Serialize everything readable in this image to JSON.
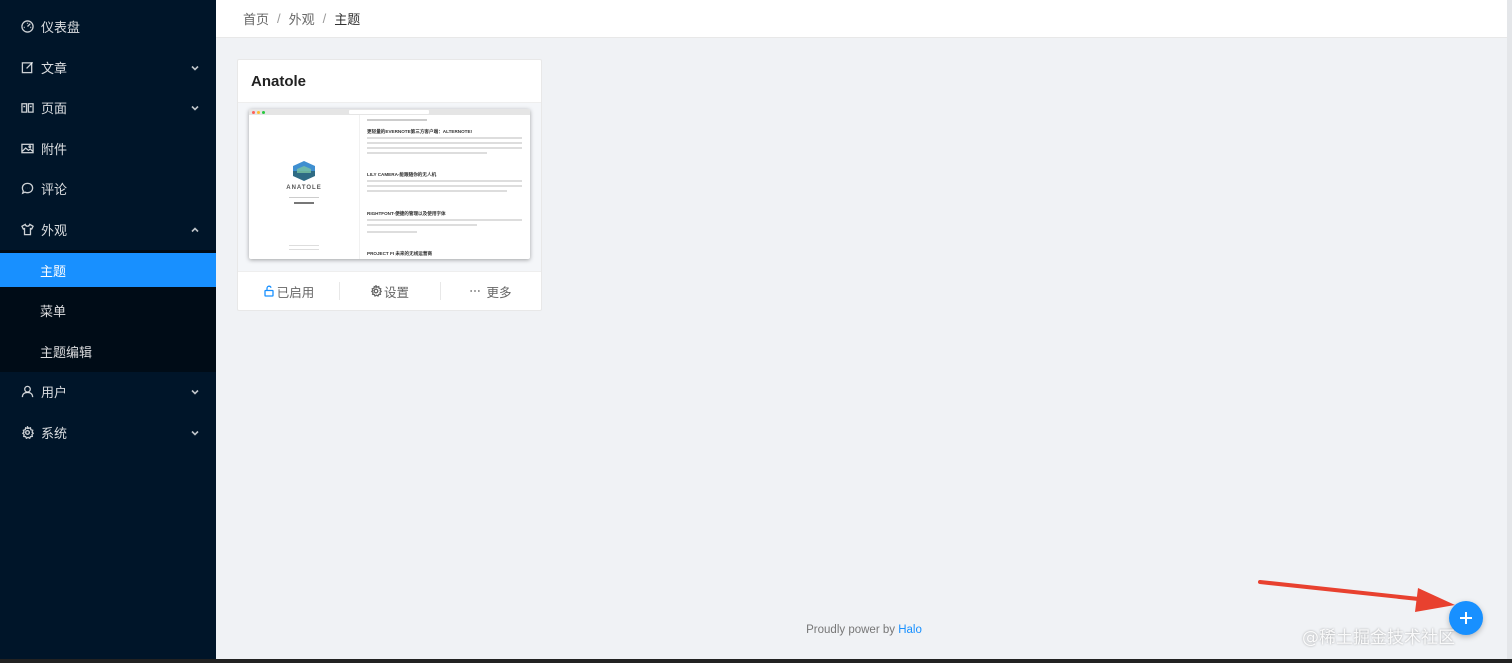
{
  "sidebar": {
    "items": [
      {
        "label": "仪表盘",
        "icon": "dashboard-icon",
        "has_arrow": false
      },
      {
        "label": "文章",
        "icon": "edit-icon",
        "has_arrow": true
      },
      {
        "label": "页面",
        "icon": "book-icon",
        "has_arrow": true
      },
      {
        "label": "附件",
        "icon": "picture-icon",
        "has_arrow": true
      },
      {
        "label": "评论",
        "icon": "comment-icon",
        "has_arrow": false
      },
      {
        "label": "外观",
        "icon": "skin-icon",
        "has_arrow": true,
        "expanded": true
      },
      {
        "label": "用户",
        "icon": "user-icon",
        "has_arrow": true
      },
      {
        "label": "系统",
        "icon": "setting-icon",
        "has_arrow": true
      }
    ],
    "submenu": [
      {
        "label": "主题",
        "active": true
      },
      {
        "label": "菜单",
        "active": false
      },
      {
        "label": "主题编辑",
        "active": false
      }
    ]
  },
  "breadcrumb": [
    "首页",
    "外观",
    "主题"
  ],
  "theme_card": {
    "title": "Anatole",
    "preview": {
      "logo_text": "ANATOLE",
      "headings": [
        "更轻量的EVERNOTE第三方客户端：ALTERNOTE!",
        "LILY CAMERA-能跟随你的无人机",
        "RIGHTFONT-便捷的管理以及使用字体",
        "PROJECT FI 未来的无线运营商"
      ]
    },
    "actions": {
      "enabled_label": "已启用",
      "settings_label": "设置",
      "more_label": "更多"
    }
  },
  "footer": {
    "text": "Proudly power by ",
    "link": "Halo"
  },
  "watermark": "@稀土掘金技术社区",
  "colors": {
    "sidebar_bg": "#001529",
    "submenu_bg": "#000c17",
    "accent": "#1890ff",
    "annotation_arrow": "#e8412f"
  }
}
